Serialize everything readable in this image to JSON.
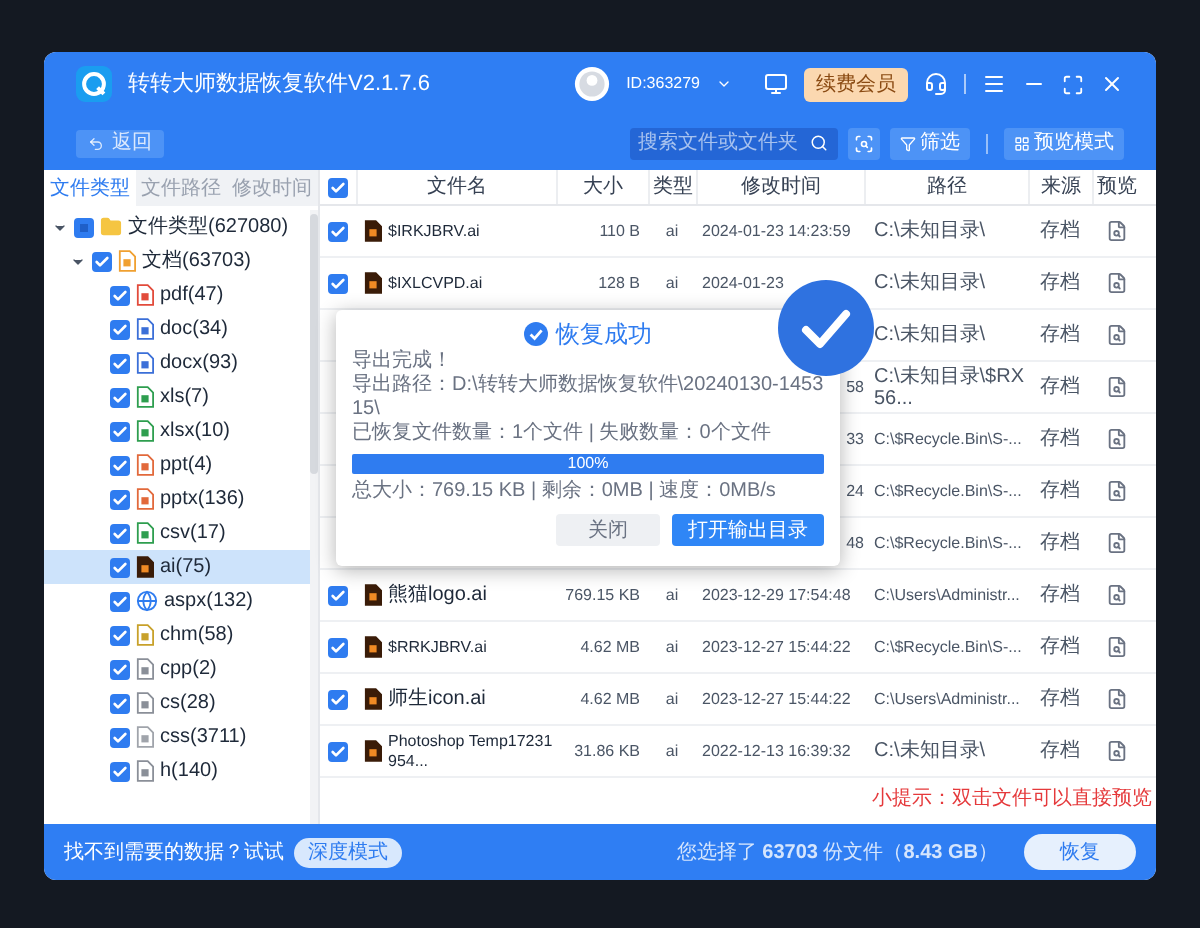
{
  "window": {
    "title": "转转大师数据恢复软件V2.1.7.6",
    "user_id": "ID:363279",
    "vip_badge": "续费会员"
  },
  "toolbar": {
    "back": "返回",
    "search": {
      "placeholder": "搜索文件或文件夹"
    },
    "filter": "筛选",
    "preview_mode": "预览模式"
  },
  "sidebar": {
    "tabs": [
      {
        "label": "文件类型",
        "selected": true
      },
      {
        "label": "文件路径",
        "selected": false
      },
      {
        "label": "修改时间",
        "selected": false
      }
    ],
    "tree": [
      {
        "label": "文件类型(627080)",
        "kind": "folder",
        "partial": true,
        "expanded": true,
        "selected": false,
        "children": [
          {
            "label": "文档(63703)",
            "kind": "document",
            "checked": true,
            "expanded": true,
            "selected": false,
            "children": [
              {
                "label": "pdf(47)",
                "kind": "pdf",
                "checked": true,
                "selected": false
              },
              {
                "label": "doc(34)",
                "kind": "word",
                "checked": true,
                "selected": false
              },
              {
                "label": "docx(93)",
                "kind": "word",
                "checked": true,
                "selected": false
              },
              {
                "label": "xls(7)",
                "kind": "excel",
                "checked": true,
                "selected": false
              },
              {
                "label": "xlsx(10)",
                "kind": "excel",
                "checked": true,
                "selected": false
              },
              {
                "label": "ppt(4)",
                "kind": "ppt",
                "checked": true,
                "selected": false
              },
              {
                "label": "pptx(136)",
                "kind": "ppt",
                "checked": true,
                "selected": false
              },
              {
                "label": "csv(17)",
                "kind": "excel",
                "checked": true,
                "selected": false
              },
              {
                "label": "ai(75)",
                "kind": "ai",
                "checked": true,
                "selected": true
              },
              {
                "label": "aspx(132)",
                "kind": "web",
                "checked": true,
                "selected": false
              },
              {
                "label": "chm(58)",
                "kind": "help",
                "checked": true,
                "selected": false
              },
              {
                "label": "cpp(2)",
                "kind": "code",
                "checked": true,
                "selected": false
              },
              {
                "label": "cs(28)",
                "kind": "code",
                "checked": true,
                "selected": false
              },
              {
                "label": "css(3711)",
                "kind": "text",
                "checked": true,
                "selected": false
              },
              {
                "label": "h(140)",
                "kind": "code",
                "checked": true,
                "selected": false
              }
            ]
          }
        ]
      }
    ]
  },
  "table": {
    "all_checked": true,
    "columns": [
      "文件名",
      "大小",
      "类型",
      "修改时间",
      "路径",
      "来源",
      "预览"
    ],
    "rows": [
      {
        "kind": "full",
        "checked": true,
        "name": "$IRKJBRV.ai",
        "size": "110 B",
        "type": "ai",
        "modified": "2024-01-23 14:23:59",
        "path": "C:\\未知目录\\",
        "source": "存档"
      },
      {
        "kind": "full",
        "checked": true,
        "name": "$IXLCVPD.ai",
        "size": "128 B",
        "type": "ai",
        "modified": "2024-01-23",
        "path": "C:\\未知目录\\",
        "source": "存档"
      },
      {
        "kind": "partial",
        "path": "C:\\未知目录\\",
        "source": "存档"
      },
      {
        "kind": "partial",
        "modified": "58",
        "path": "C:\\未知目录\\$RX56...",
        "source": "存档"
      },
      {
        "kind": "partial",
        "modified": "33",
        "path": "C:\\$Recycle.Bin\\S-...",
        "source": "存档"
      },
      {
        "kind": "partial",
        "modified": "24",
        "path": "C:\\$Recycle.Bin\\S-...",
        "source": "存档"
      },
      {
        "kind": "partial",
        "modified": "48",
        "path": "C:\\$Recycle.Bin\\S-...",
        "source": "存档"
      },
      {
        "kind": "full",
        "checked": true,
        "name": "熊猫logo.ai",
        "size": "769.15 KB",
        "type": "ai",
        "modified": "2023-12-29 17:54:48",
        "path": "C:\\Users\\Administr...",
        "source": "存档"
      },
      {
        "kind": "full",
        "checked": true,
        "name": "$RRKJBRV.ai",
        "size": "4.62 MB",
        "type": "ai",
        "modified": "2023-12-27 15:44:22",
        "path": "C:\\$Recycle.Bin\\S-...",
        "source": "存档"
      },
      {
        "kind": "full",
        "checked": true,
        "name": "师生icon.ai",
        "size": "4.62 MB",
        "type": "ai",
        "modified": "2023-12-27 15:44:22",
        "path": "C:\\Users\\Administr...",
        "source": "存档"
      },
      {
        "kind": "full",
        "checked": true,
        "name": "Photoshop Temp17231954...",
        "size": "31.86 KB",
        "type": "ai",
        "modified": "2022-12-13 16:39:32",
        "path": "C:\\未知目录\\",
        "source": "存档"
      }
    ]
  },
  "hint": "小提示：双击文件可以直接预览",
  "dialog": {
    "title": "恢复成功",
    "status": "导出完成！",
    "path": "导出路径：D:\\转转大师数据恢复软件\\20240130-145315\\",
    "counts": "已恢复文件数量：1个文件 | 失败数量：0个文件",
    "progress": {
      "level": 1,
      "label": "100%"
    },
    "summary": "总大小：769.15 KB | 剩余：0MB | 速度：0MB/s",
    "buttons": [
      "关闭",
      "打开输出目录"
    ]
  },
  "footer": {
    "prompt": "找不到需要的数据？试试",
    "deep_mode": "深度模式",
    "selection": "您选择了 **63703** 份文件（**8.43 GB**）",
    "recover": "恢复"
  }
}
